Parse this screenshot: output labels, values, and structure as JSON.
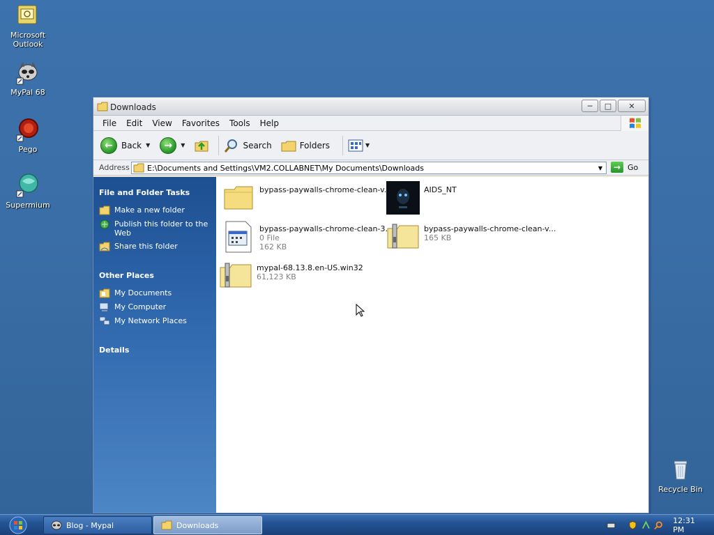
{
  "desktop": {
    "icons": [
      {
        "label": "Microsoft Outlook"
      },
      {
        "label": "MyPal 68"
      },
      {
        "label": "Pego"
      },
      {
        "label": "Supermium"
      },
      {
        "label": "Recycle Bin"
      }
    ]
  },
  "window": {
    "title": "Downloads",
    "menu": [
      "File",
      "Edit",
      "View",
      "Favorites",
      "Tools",
      "Help"
    ],
    "toolbar": {
      "back_label": "Back",
      "search_label": "Search",
      "folders_label": "Folders"
    },
    "address": {
      "label": "Address",
      "value": "E:\\Documents and Settings\\VM2.COLLABNET\\My Documents\\Downloads",
      "go_label": "Go"
    },
    "taskpane": {
      "file_folder_tasks": {
        "heading": "File and Folder Tasks",
        "items": [
          "Make a new folder",
          "Publish this folder to the Web",
          "Share this folder"
        ]
      },
      "other_places": {
        "heading": "Other Places",
        "items": [
          "My Documents",
          "My Computer",
          "My Network Places"
        ]
      },
      "details": {
        "heading": "Details"
      }
    },
    "files": [
      {
        "name": "bypass-paywalls-chrome-clean-v...",
        "type": "",
        "size": "",
        "icon": "folder-icon"
      },
      {
        "name": "AIDS_NT",
        "type": "",
        "size": "",
        "icon": "image-thumbnail"
      },
      {
        "name": "bypass-paywalls-chrome-clean-3....",
        "type": "0 File",
        "size": "162 KB",
        "icon": "file-icon"
      },
      {
        "name": "bypass-paywalls-chrome-clean-v...",
        "type": "",
        "size": "165 KB",
        "icon": "zip-folder-icon"
      },
      {
        "name": "mypal-68.13.8.en-US.win32",
        "type": "",
        "size": "61,123 KB",
        "icon": "zip-folder-icon"
      }
    ]
  },
  "taskbar": {
    "buttons": [
      {
        "label": "Blog - Mypal",
        "active": false
      },
      {
        "label": "Downloads",
        "active": true
      }
    ],
    "clock": "12:31 PM"
  }
}
